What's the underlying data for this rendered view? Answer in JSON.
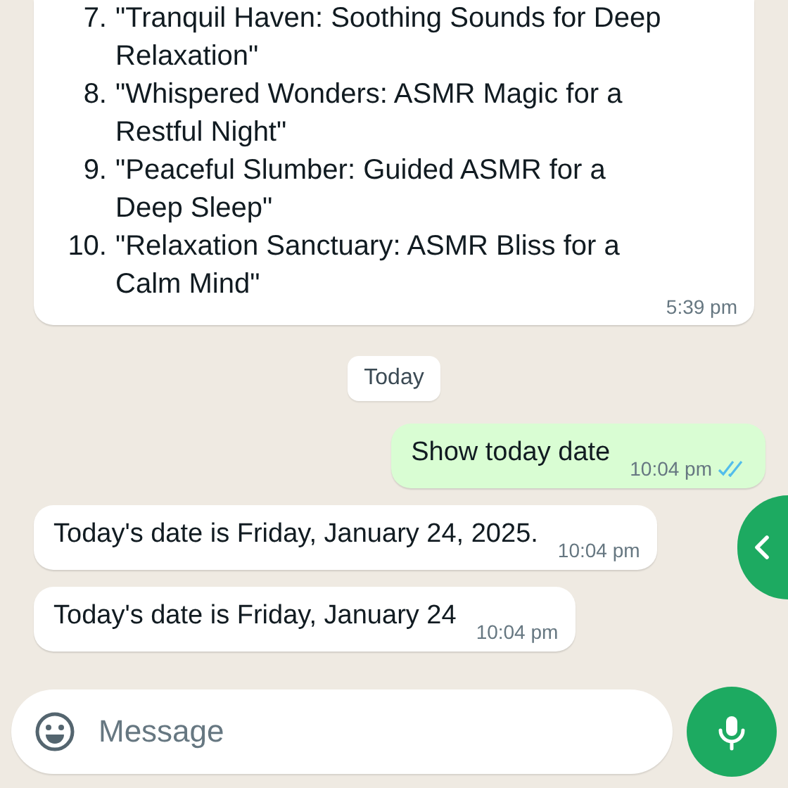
{
  "messages": [
    {
      "kind": "list",
      "sent": false,
      "items": [
        {
          "number": "7.",
          "text": "\"Tranquil Haven: Soothing Sounds for Deep Relaxation\""
        },
        {
          "number": "8.",
          "text": "\"Whispered Wonders: ASMR Magic for a Restful Night\""
        },
        {
          "number": "9.",
          "text": "\"Peaceful Slumber: Guided ASMR for a Deep Sleep\""
        },
        {
          "number": "10.",
          "text": "\"Relaxation Sanctuary: ASMR Bliss for a Calm Mind\""
        }
      ],
      "time": "5:39 pm"
    },
    {
      "kind": "date",
      "text": "Today"
    },
    {
      "kind": "text",
      "sent": true,
      "text": "Show today date",
      "time": "10:04 pm",
      "read": true
    },
    {
      "kind": "text",
      "sent": false,
      "text": "Today's date is Friday, January 24, 2025.",
      "time": "10:04 pm"
    },
    {
      "kind": "text",
      "sent": false,
      "text": "Today's date is Friday, January 24",
      "time": "10:04 pm"
    }
  ],
  "composer": {
    "placeholder": "Message"
  }
}
